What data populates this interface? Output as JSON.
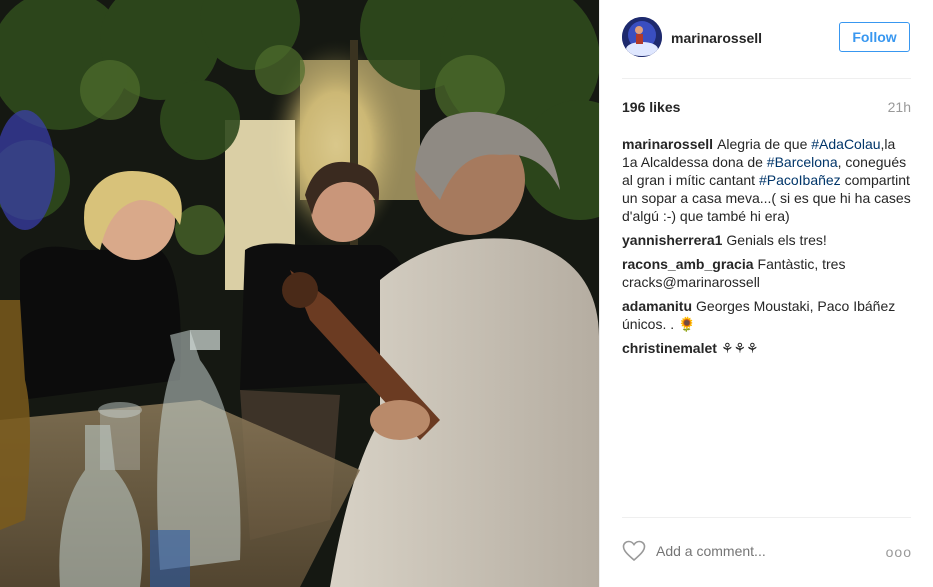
{
  "post": {
    "username": "marinarossell",
    "follow_label": "Follow",
    "likes": "196 likes",
    "time": "21h",
    "add_comment_placeholder": "Add a comment...",
    "more_label": "ooo"
  },
  "caption": {
    "user": "marinarossell",
    "text1": "Alegria de que ",
    "tag1": "#AdaColau",
    "text2": ",la 1a Alcaldessa dona de ",
    "tag2": "#Barcelona",
    "text3": ", conegués al gran i mític cantant ",
    "tag3": "#PacoIbañez",
    "text4": " compartint un sopar a casa meva...( si es que hi ha cases d'algú :-) que també hi era)"
  },
  "comments": [
    {
      "user": "yannisherrera1",
      "text": "Genials els tres!"
    },
    {
      "user": "racons_amb_gracia",
      "text": "Fantàstic, tres cracks@marinarossell"
    },
    {
      "user": "adamanitu",
      "text": "Georges Moustaki, Paco Ibáñez únicos. . 🌻"
    },
    {
      "user": "christinemalet",
      "text": "⚘⚘⚘"
    }
  ],
  "colors": {
    "accent": "#3897f0",
    "hashtag": "#003569",
    "muted": "#999999"
  },
  "icons": {
    "heart": "heart-icon",
    "more": "more-options-icon"
  }
}
